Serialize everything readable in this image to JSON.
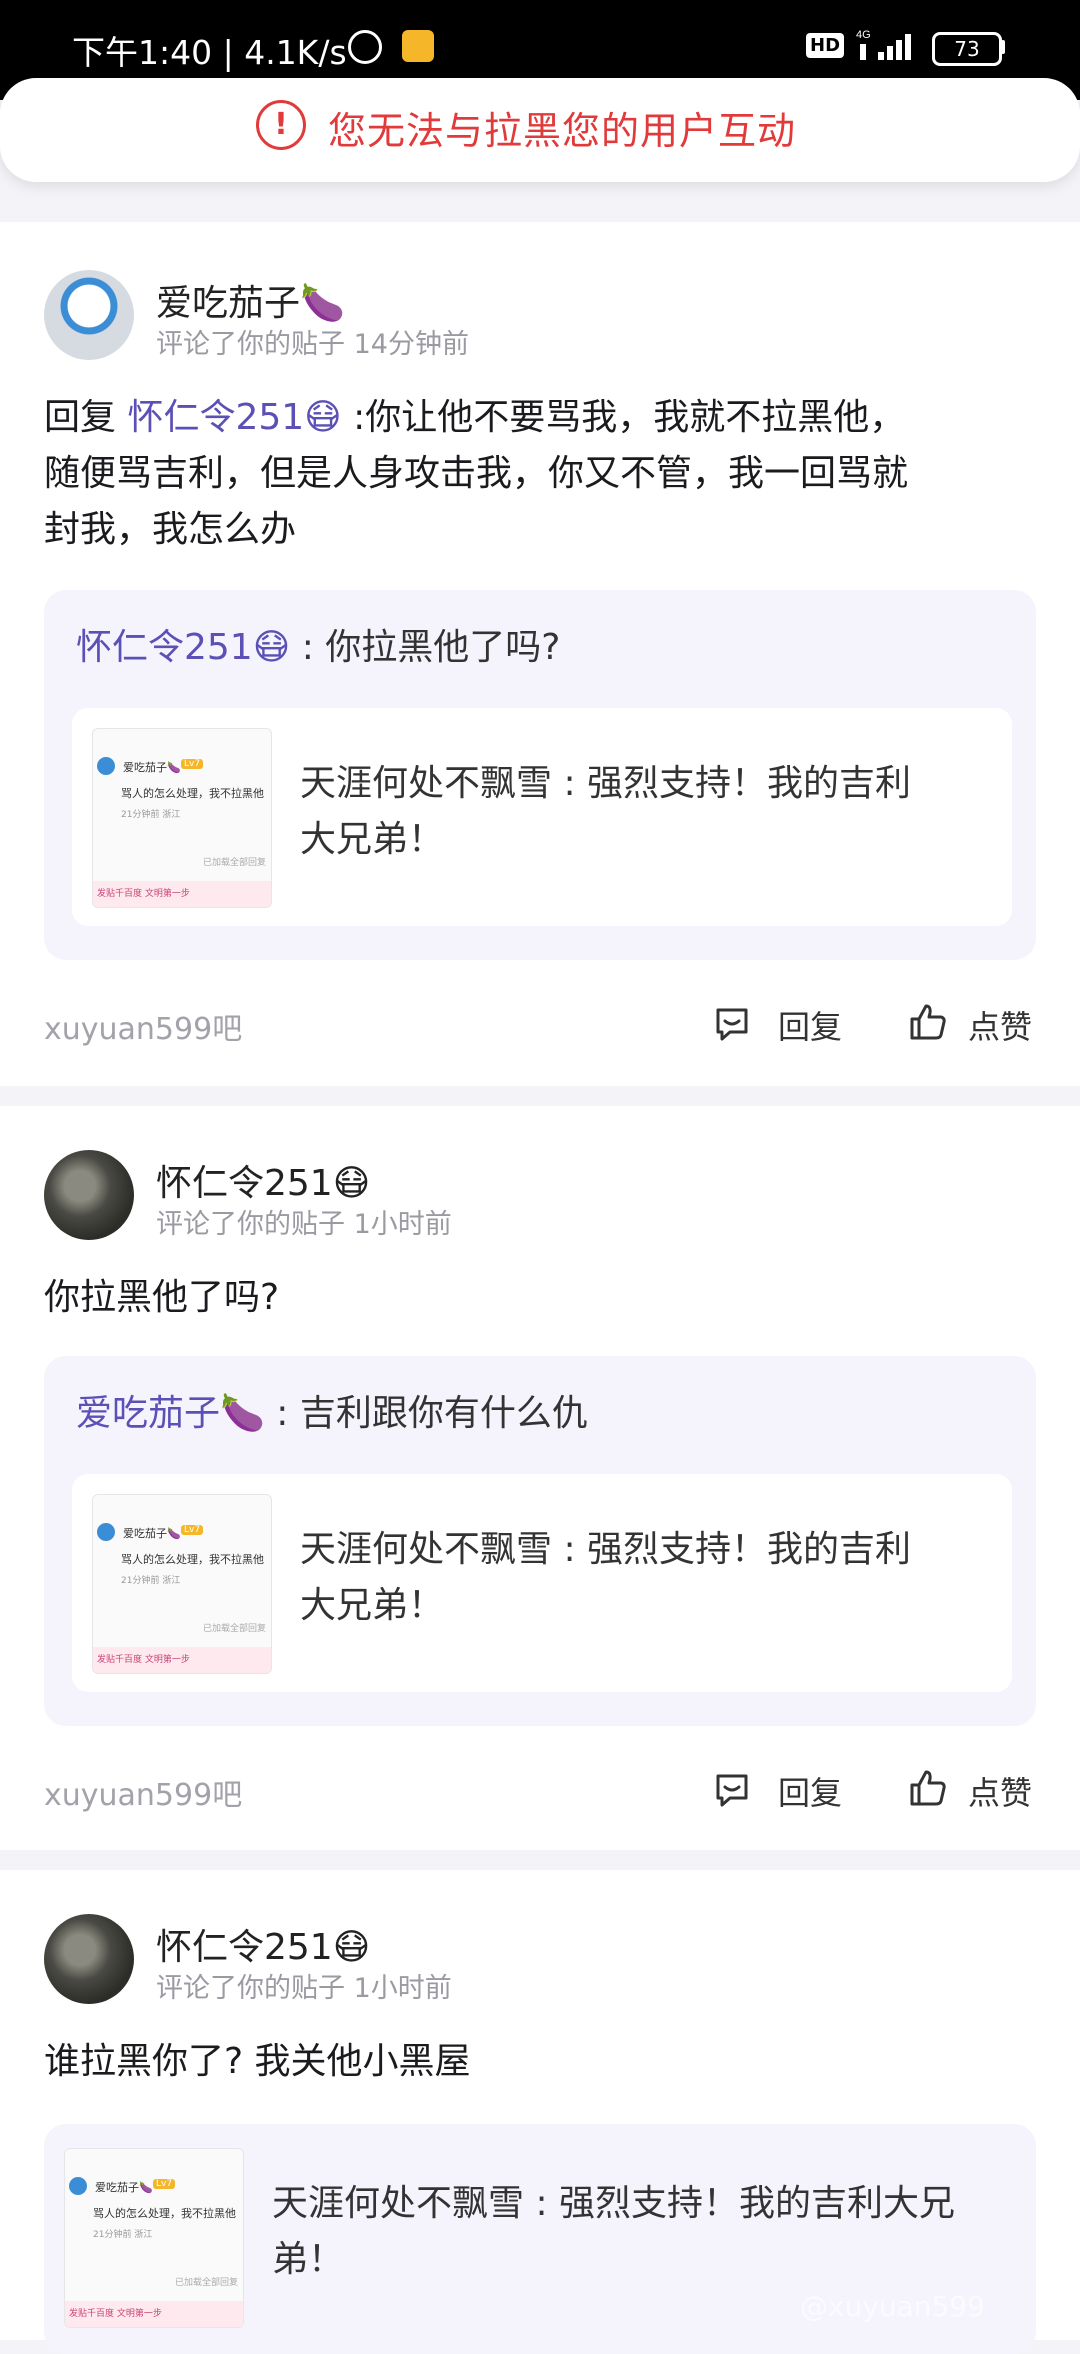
{
  "status_bar": {
    "time_speed": "下午1:40 | 4.1K/s",
    "hd": "HD",
    "network": "4G",
    "battery": "73"
  },
  "toast": {
    "message": "您无法与拉黑您的用户互动",
    "icon": "alert-circle-icon",
    "color": "#e03a3a"
  },
  "accent_color": "#5b50b5",
  "messages": [
    {
      "username": "爱吃茄子🍆",
      "subtitle": "评论了你的贴子  14分钟前",
      "reply_prefix": "回复 ",
      "reply_mention": "怀仁令251😷",
      "reply_line1_rest": " :你让他不要骂我，我就不拉黑他，",
      "reply_line2": "随便骂吉利，但是人身攻击我，你又不管，我一回骂就",
      "reply_line3": "封我，我怎么办",
      "quote_user": "怀仁令251😷",
      "quote_text": " : 你拉黑他了吗?",
      "post_line1": "天涯何处不飘雪 : 强烈支持！我的吉利",
      "post_line2": "大兄弟！",
      "forum": "xuyuan599吧",
      "reply_label": "回复",
      "like_label": "点赞"
    },
    {
      "username": "怀仁令251😷",
      "subtitle": "评论了你的贴子  1小时前",
      "text": "你拉黑他了吗?",
      "quote_user": "爱吃茄子🍆",
      "quote_text": " : 吉利跟你有什么仇",
      "post_line1": "天涯何处不飘雪 : 强烈支持！我的吉利",
      "post_line2": "大兄弟！",
      "forum": "xuyuan599吧",
      "reply_label": "回复",
      "like_label": "点赞"
    },
    {
      "username": "怀仁令251😷",
      "subtitle": "评论了你的贴子  1小时前",
      "text": "谁拉黑你了? 我关他小黑屋",
      "post_line1": "天涯何处不飘雪 : 强烈支持！我的吉利大兄",
      "post_line2": "弟！"
    }
  ],
  "thumbnail": {
    "name": "爱吃茄子🍆",
    "badge": "Lv7",
    "line": "骂人的怎么处理，我不拉黑他",
    "meta": "21分钟前  浙江",
    "more": "已加载全部回复",
    "footer": "发贴千百度 文明第一步"
  },
  "watermark": "@xuyuan599"
}
